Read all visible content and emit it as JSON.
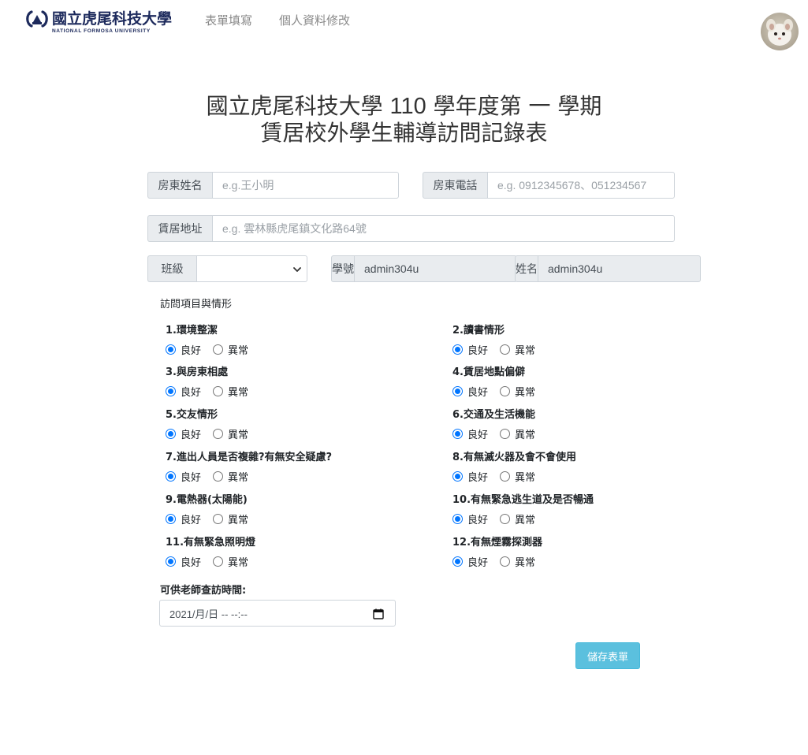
{
  "nav": {
    "logo_zh": "國立虎尾科技大學",
    "logo_en": "NATIONAL FORMOSA UNIVERSITY",
    "links": [
      "表單填寫",
      "個人資料修改"
    ]
  },
  "title": {
    "line1_prefix": "國立虎尾科技大學",
    "year": "110",
    "line1_suffix": "學年度第 一 學期",
    "line2": "賃居校外學生輔導訪問記錄表"
  },
  "fields": {
    "landlord_name": {
      "label": "房東姓名",
      "placeholder": "e.g.王小明"
    },
    "landlord_phone": {
      "label": "房東電話",
      "placeholder": "e.g. 0912345678、051234567"
    },
    "address": {
      "label": "賃居地址",
      "placeholder": "e.g. 雲林縣虎尾鎮文化路64號"
    },
    "class": {
      "label": "班級",
      "value": ""
    },
    "student_id": {
      "label": "學號",
      "value": "admin304u"
    },
    "name": {
      "label": "姓名",
      "value": "admin304u"
    }
  },
  "visit": {
    "section_label": "訪問項目與情形",
    "options": {
      "good": "良好",
      "abnormal": "異常"
    },
    "items": [
      {
        "label": "1.環境整潔",
        "selected": "good"
      },
      {
        "label": "2.讀書情形",
        "selected": "good"
      },
      {
        "label": "3.與房東相處",
        "selected": "good"
      },
      {
        "label": "4.賃居地點偏僻",
        "selected": "good"
      },
      {
        "label": "5.交友情形",
        "selected": "good"
      },
      {
        "label": "6.交通及生活機能",
        "selected": "good"
      },
      {
        "label": "7.進出人員是否複雜?有無安全疑慮?",
        "selected": "good"
      },
      {
        "label": "8.有無滅火器及會不會使用",
        "selected": "good"
      },
      {
        "label": "9.電熱器(太陽能)",
        "selected": "good"
      },
      {
        "label": "10.有無緊急逃生道及是否暢通",
        "selected": "good"
      },
      {
        "label": "11.有無緊急照明燈",
        "selected": "good"
      },
      {
        "label": "12.有無煙霧探測器",
        "selected": "good"
      }
    ]
  },
  "time": {
    "label": "可供老師查訪時間:",
    "value": "2021/月/日 -- --:--"
  },
  "buttons": {
    "save": "儲存表單"
  },
  "colors": {
    "accent": "#0075ff",
    "save_button": "#5bc0de",
    "logo": "#1d2a5c"
  }
}
